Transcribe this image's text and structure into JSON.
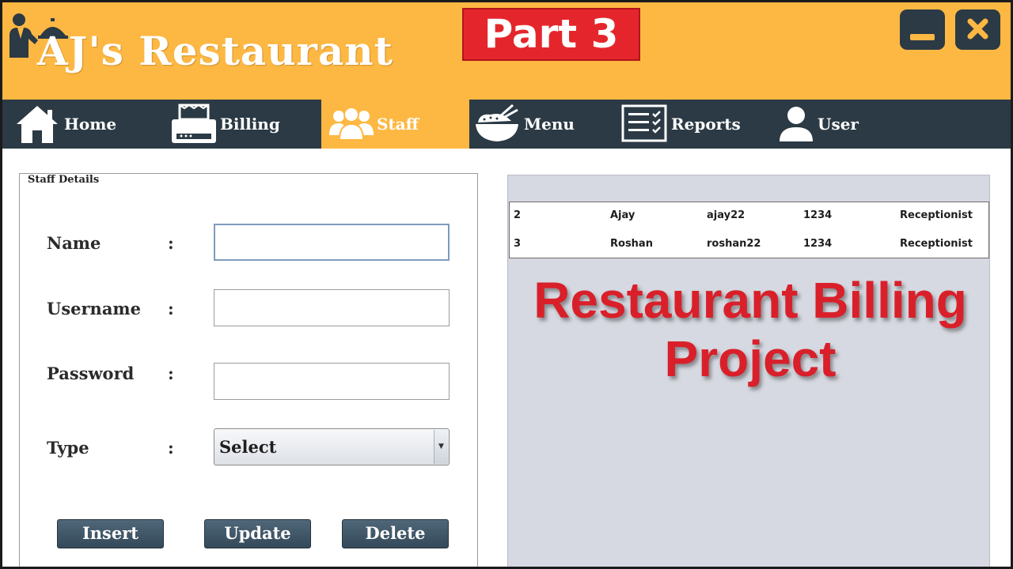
{
  "app": {
    "title": "AJ's Restaurant",
    "badge": "Part 3"
  },
  "window_controls": {
    "minimize_icon": "minimize-icon",
    "close_icon": "close-icon"
  },
  "nav": {
    "items": [
      {
        "label": "Home",
        "icon": "home-icon"
      },
      {
        "label": "Billing",
        "icon": "printer-icon"
      },
      {
        "label": "Staff",
        "icon": "staff-group-icon",
        "active": true
      },
      {
        "label": "Menu",
        "icon": "food-bowl-icon"
      },
      {
        "label": "Reports",
        "icon": "checklist-icon"
      },
      {
        "label": "User",
        "icon": "user-icon"
      }
    ]
  },
  "staff_form": {
    "title": "Staff Details",
    "name_label": "Name",
    "username_label": "Username",
    "password_label": "Password",
    "type_label": "Type",
    "colon": ":",
    "name_value": "",
    "username_value": "",
    "password_value": "",
    "type_selected": "Select",
    "insert_label": "Insert",
    "update_label": "Update",
    "delete_label": "Delete"
  },
  "staff_table": {
    "rows": [
      [
        "2",
        "Ajay",
        "ajay22",
        "1234",
        "Receptionist"
      ],
      [
        "3",
        "Roshan",
        "roshan22",
        "1234",
        "Receptionist"
      ]
    ]
  },
  "overlay": {
    "line1": "Restaurant Billing",
    "line2": "Project"
  },
  "colors": {
    "accent": "#fdb843",
    "nav_bg": "#2b3a44",
    "badge": "#e4262c",
    "overlay_text": "#d9202a"
  }
}
